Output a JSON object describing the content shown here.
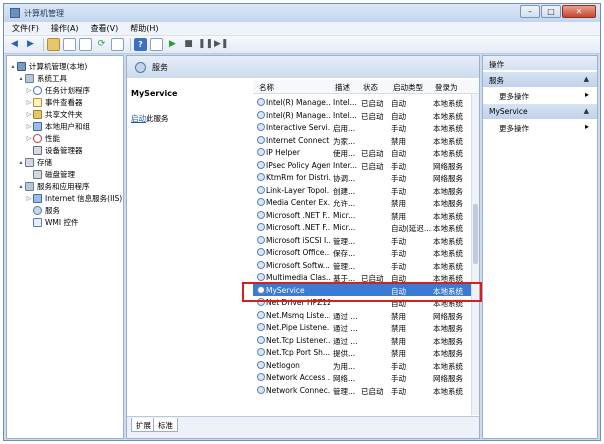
{
  "window": {
    "title": "计算机管理"
  },
  "menu": [
    "文件(F)",
    "操作(A)",
    "查看(V)",
    "帮助(H)"
  ],
  "tree": [
    {
      "label": "计算机管理(本地)",
      "icon": "computer-icon",
      "expand": "▴"
    },
    {
      "label": "系统工具",
      "icon": "tools-icon",
      "expand": "▴"
    },
    {
      "label": "任务计划程序",
      "icon": "task-scheduler-icon",
      "expand": "▷"
    },
    {
      "label": "事件查看器",
      "icon": "event-viewer-icon",
      "expand": "▷"
    },
    {
      "label": "共享文件夹",
      "icon": "shared-folder-icon",
      "expand": "▷"
    },
    {
      "label": "本地用户和组",
      "icon": "users-icon",
      "expand": "▷"
    },
    {
      "label": "性能",
      "icon": "performance-icon",
      "expand": "▷"
    },
    {
      "label": "设备管理器",
      "icon": "device-manager-icon",
      "expand": ""
    },
    {
      "label": "存储",
      "icon": "storage-icon",
      "expand": "▴"
    },
    {
      "label": "磁盘管理",
      "icon": "disk-icon",
      "expand": ""
    },
    {
      "label": "服务和应用程序",
      "icon": "services-apps-icon",
      "expand": "▴"
    },
    {
      "label": "Internet 信息服务(IIS)管",
      "icon": "iis-icon",
      "expand": "▷"
    },
    {
      "label": "服务",
      "icon": "services-icon",
      "expand": ""
    },
    {
      "label": "WMI 控件",
      "icon": "wmi-icon",
      "expand": ""
    }
  ],
  "center": {
    "header": "服务",
    "selected_service": "MyService",
    "start_link": "启动",
    "start_suffix": "此服务"
  },
  "columns": [
    "名称",
    "描述",
    "状态",
    "启动类型",
    "登录为"
  ],
  "services": [
    {
      "name": "Intel(R) Manage...",
      "desc": "Intel...",
      "status": "已启动",
      "start": "自动",
      "logon": "本地系统"
    },
    {
      "name": "Intel(R) Manage...",
      "desc": "Intel...",
      "status": "已启动",
      "start": "自动",
      "logon": "本地系统"
    },
    {
      "name": "Interactive Servi...",
      "desc": "启用...",
      "status": "",
      "start": "手动",
      "logon": "本地系统"
    },
    {
      "name": "Internet Connect...",
      "desc": "为家...",
      "status": "",
      "start": "禁用",
      "logon": "本地系统"
    },
    {
      "name": "IP Helper",
      "desc": "使用...",
      "status": "已启动",
      "start": "自动",
      "logon": "本地系统"
    },
    {
      "name": "IPsec Policy Agent",
      "desc": "Inter...",
      "status": "已启动",
      "start": "手动",
      "logon": "网络服务"
    },
    {
      "name": "KtmRm for Distri...",
      "desc": "协调...",
      "status": "",
      "start": "手动",
      "logon": "网络服务"
    },
    {
      "name": "Link-Layer Topol...",
      "desc": "创建...",
      "status": "",
      "start": "手动",
      "logon": "本地服务"
    },
    {
      "name": "Media Center Ex...",
      "desc": "允许...",
      "status": "",
      "start": "禁用",
      "logon": "本地服务"
    },
    {
      "name": "Microsoft .NET F...",
      "desc": "Micr...",
      "status": "",
      "start": "禁用",
      "logon": "本地系统"
    },
    {
      "name": "Microsoft .NET F...",
      "desc": "Micr...",
      "status": "",
      "start": "自动(延迟...",
      "logon": "本地系统"
    },
    {
      "name": "Microsoft iSCSI I...",
      "desc": "管理...",
      "status": "",
      "start": "手动",
      "logon": "本地系统"
    },
    {
      "name": "Microsoft Office...",
      "desc": "保存...",
      "status": "",
      "start": "手动",
      "logon": "本地系统"
    },
    {
      "name": "Microsoft Softw...",
      "desc": "管理...",
      "status": "",
      "start": "手动",
      "logon": "本地系统"
    },
    {
      "name": "Multimedia Clas...",
      "desc": "基于...",
      "status": "已启动",
      "start": "自动",
      "logon": "本地系统"
    },
    {
      "name": "MyService",
      "desc": "",
      "status": "",
      "start": "自动",
      "logon": "本地系统"
    },
    {
      "name": "Net Driver HPZ12",
      "desc": "",
      "status": "",
      "start": "自动",
      "logon": "本地系统"
    },
    {
      "name": "Net.Msmq Liste...",
      "desc": "通过 ...",
      "status": "",
      "start": "禁用",
      "logon": "网络服务"
    },
    {
      "name": "Net.Pipe Listene...",
      "desc": "通过 ...",
      "status": "",
      "start": "禁用",
      "logon": "本地服务"
    },
    {
      "name": "Net.Tcp Listener...",
      "desc": "通过 ...",
      "status": "",
      "start": "禁用",
      "logon": "本地服务"
    },
    {
      "name": "Net.Tcp Port Sh...",
      "desc": "提供...",
      "status": "",
      "start": "禁用",
      "logon": "本地服务"
    },
    {
      "name": "Netlogon",
      "desc": "为用...",
      "status": "",
      "start": "手动",
      "logon": "本地系统"
    },
    {
      "name": "Network Access ...",
      "desc": "网络...",
      "status": "",
      "start": "手动",
      "logon": "网络服务"
    },
    {
      "name": "Network Connec...",
      "desc": "管理...",
      "status": "已启动",
      "start": "手动",
      "logon": "本地系统"
    }
  ],
  "selected_index": 15,
  "tabs": [
    "扩展",
    "标准"
  ],
  "actions": {
    "title": "操作",
    "sections": [
      {
        "header": "服务",
        "item": "更多操作"
      },
      {
        "header": "MyService",
        "item": "更多操作"
      }
    ]
  },
  "colors": {
    "highlight_box": "#d62020",
    "selection": "#3a7bd5",
    "link": "#1a55b5"
  }
}
